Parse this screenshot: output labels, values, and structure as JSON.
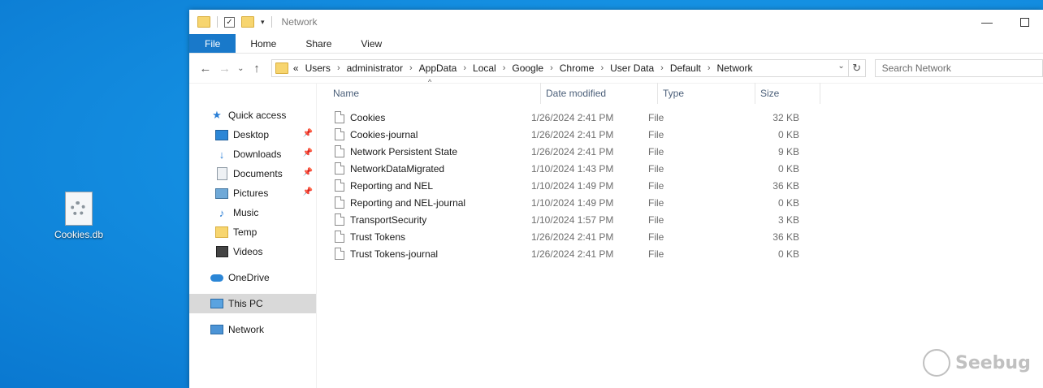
{
  "desktop": {
    "file_label": "Cookies.db"
  },
  "window": {
    "title": "Network"
  },
  "ribbon": {
    "tabs": [
      "File",
      "Home",
      "Share",
      "View"
    ]
  },
  "address": {
    "crumbs": [
      "Users",
      "administrator",
      "AppData",
      "Local",
      "Google",
      "Chrome",
      "User Data",
      "Default",
      "Network"
    ],
    "overflow": "«"
  },
  "search": {
    "placeholder": "Search Network"
  },
  "navpane": {
    "quick_access": "Quick access",
    "items": [
      "Desktop",
      "Downloads",
      "Documents",
      "Pictures",
      "Music",
      "Temp",
      "Videos"
    ],
    "onedrive": "OneDrive",
    "this_pc": "This PC",
    "network": "Network"
  },
  "columns": {
    "name": "Name",
    "date": "Date modified",
    "type": "Type",
    "size": "Size"
  },
  "files": [
    {
      "name": "Cookies",
      "date": "1/26/2024 2:41 PM",
      "type": "File",
      "size": "32 KB"
    },
    {
      "name": "Cookies-journal",
      "date": "1/26/2024 2:41 PM",
      "type": "File",
      "size": "0 KB"
    },
    {
      "name": "Network Persistent State",
      "date": "1/26/2024 2:41 PM",
      "type": "File",
      "size": "9 KB"
    },
    {
      "name": "NetworkDataMigrated",
      "date": "1/10/2024 1:43 PM",
      "type": "File",
      "size": "0 KB"
    },
    {
      "name": "Reporting and NEL",
      "date": "1/10/2024 1:49 PM",
      "type": "File",
      "size": "36 KB"
    },
    {
      "name": "Reporting and NEL-journal",
      "date": "1/10/2024 1:49 PM",
      "type": "File",
      "size": "0 KB"
    },
    {
      "name": "TransportSecurity",
      "date": "1/10/2024 1:57 PM",
      "type": "File",
      "size": "3 KB"
    },
    {
      "name": "Trust Tokens",
      "date": "1/26/2024 2:41 PM",
      "type": "File",
      "size": "36 KB"
    },
    {
      "name": "Trust Tokens-journal",
      "date": "1/26/2024 2:41 PM",
      "type": "File",
      "size": "0 KB"
    }
  ],
  "watermark": "Seebug"
}
